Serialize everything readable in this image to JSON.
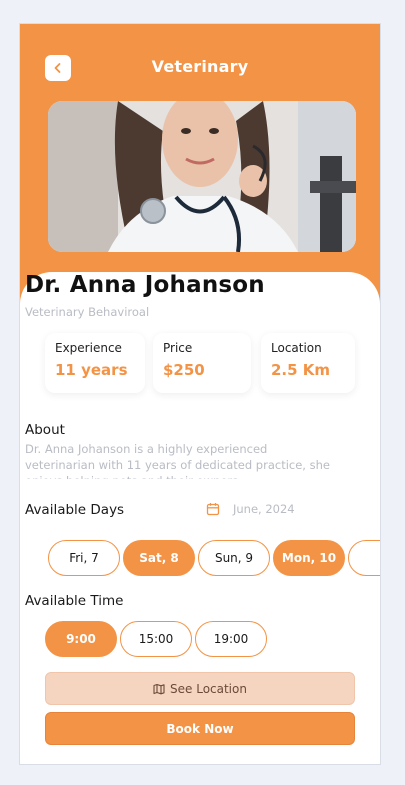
{
  "header": {
    "title": "Veterinary",
    "back_icon": "chevron-left-icon"
  },
  "doctor": {
    "name": "Dr. Anna Johanson",
    "specialty": "Veterinary Behaviroal"
  },
  "stats": [
    {
      "label": "Experience",
      "value": "11 years"
    },
    {
      "label": "Price",
      "value": "$250"
    },
    {
      "label": "Location",
      "value": "2.5 Km"
    }
  ],
  "about": {
    "heading": "About",
    "text": "Dr. Anna Johanson is a highly experienced veterinarian with 11 years of dedicated practice, she enjoys helping pets and their owners."
  },
  "days": {
    "heading": "Available Days",
    "month": "June, 2024",
    "calendar_icon": "calendar-icon",
    "items": [
      {
        "label": "Fri, 7",
        "selected": false
      },
      {
        "label": "Sat, 8",
        "selected": true
      },
      {
        "label": "Sun, 9",
        "selected": false
      },
      {
        "label": "Mon, 10",
        "selected": true
      },
      {
        "label": "",
        "selected": false
      }
    ]
  },
  "times": {
    "heading": "Available Time",
    "items": [
      {
        "label": "9:00",
        "selected": true
      },
      {
        "label": "15:00",
        "selected": false
      },
      {
        "label": "19:00",
        "selected": false
      }
    ]
  },
  "actions": {
    "see_location": "See Location",
    "map_icon": "map-icon",
    "book_now": "Book Now"
  },
  "colors": {
    "accent": "#f39345",
    "accent_light": "#f6d5c0",
    "muted_text": "#b9bcc4",
    "background": "#eef1f8"
  }
}
